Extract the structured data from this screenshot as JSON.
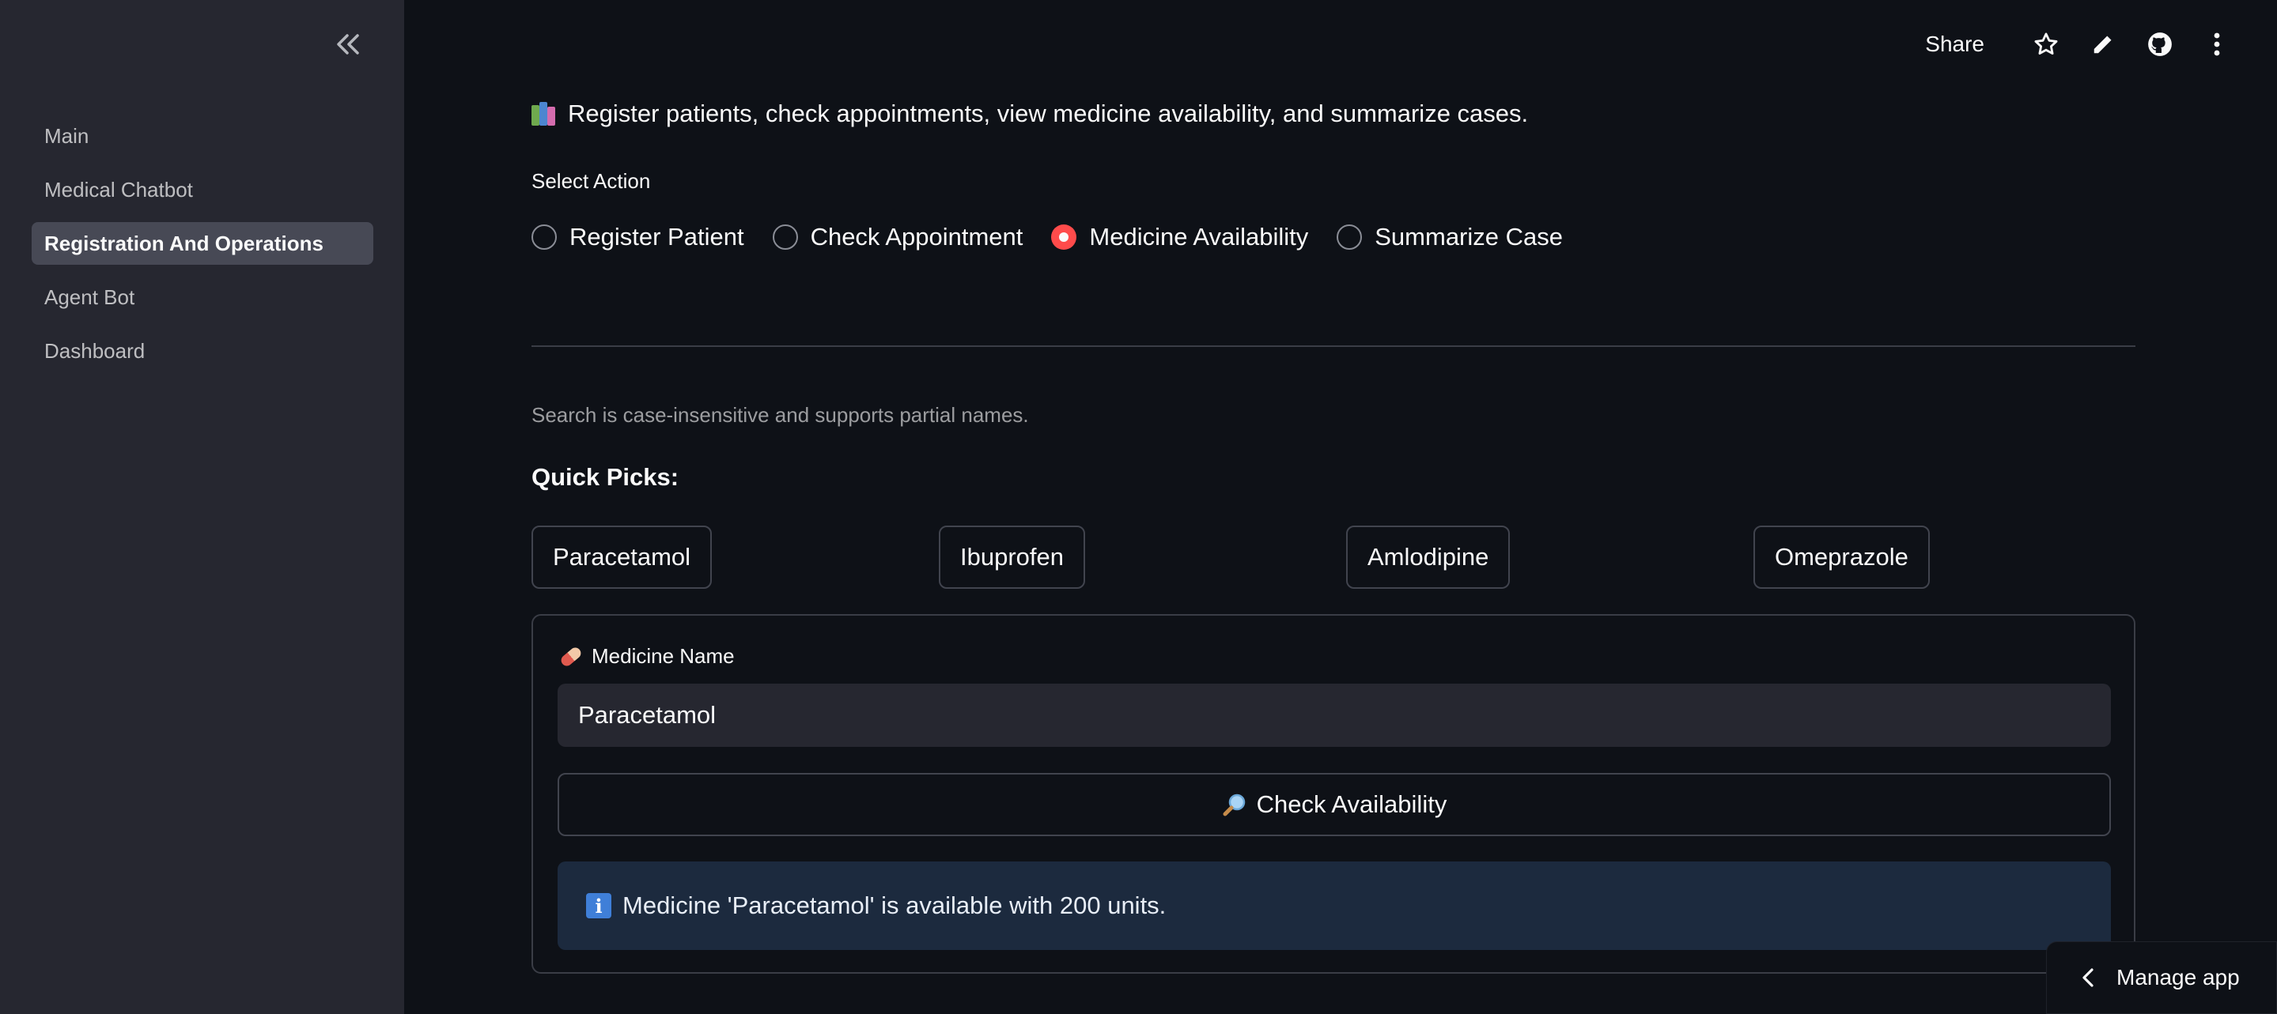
{
  "sidebar": {
    "items": [
      {
        "label": "Main"
      },
      {
        "label": "Medical Chatbot"
      },
      {
        "label": "Registration And Operations",
        "active": true
      },
      {
        "label": "Agent Bot"
      },
      {
        "label": "Dashboard"
      }
    ]
  },
  "header": {
    "share_label": "Share",
    "icons": [
      "star-icon",
      "edit-icon",
      "github-icon",
      "more-vert-icon"
    ]
  },
  "main": {
    "intro": "Register patients, check appointments, view medicine availability, and summarize cases.",
    "select_label": "Select Action",
    "actions": [
      {
        "label": "Register Patient",
        "selected": false
      },
      {
        "label": "Check Appointment",
        "selected": false
      },
      {
        "label": "Medicine Availability",
        "selected": true
      },
      {
        "label": "Summarize Case",
        "selected": false
      }
    ],
    "caption": "Search is case-insensitive and supports partial names.",
    "quick_title": "Quick Picks:",
    "quick_picks": [
      "Paracetamol",
      "Ibuprofen",
      "Amlodipine",
      "Omeprazole"
    ],
    "form": {
      "field_label": "Medicine Name",
      "field_value": "Paracetamol",
      "button_label": "Check Availability",
      "result": "Medicine 'Paracetamol' is available with 200 units."
    }
  },
  "footer": {
    "manage_label": "Manage app"
  },
  "colors": {
    "accent": "#ff4b4b",
    "sidebar": "#262730",
    "background": "#0e1117",
    "info_bg": "#1c2a3e"
  }
}
